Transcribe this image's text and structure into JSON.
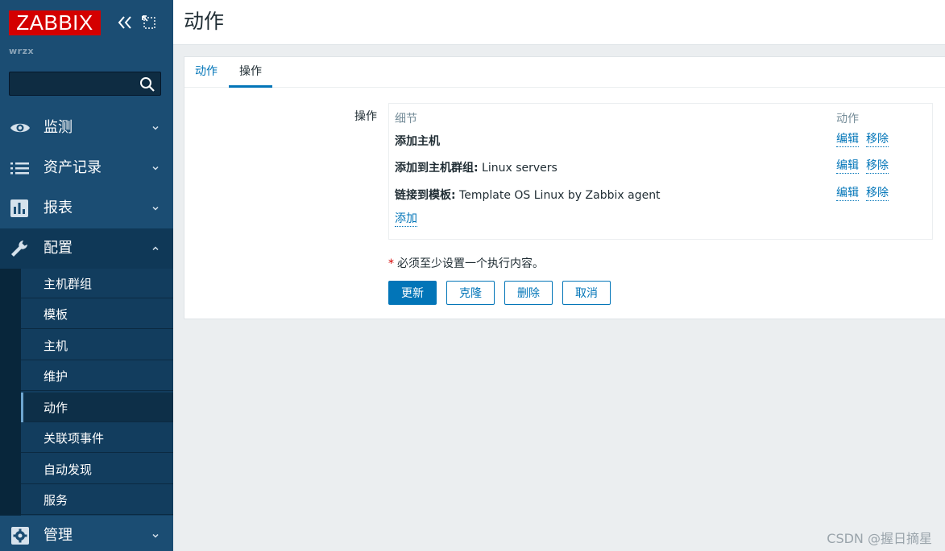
{
  "sidebar": {
    "logo": "ZABBIX",
    "server_name": "wrzx",
    "search": {
      "value": "",
      "placeholder": ""
    },
    "menu": [
      {
        "label": "监测",
        "icon": "eye-icon",
        "expanded": false
      },
      {
        "label": "资产记录",
        "icon": "list-icon",
        "expanded": false
      },
      {
        "label": "报表",
        "icon": "bar-chart-icon",
        "expanded": false
      },
      {
        "label": "配置",
        "icon": "wrench-icon",
        "expanded": true
      },
      {
        "label": "管理",
        "icon": "gear-icon",
        "expanded": false
      }
    ],
    "submenu": [
      {
        "label": "主机群组"
      },
      {
        "label": "模板"
      },
      {
        "label": "主机"
      },
      {
        "label": "维护"
      },
      {
        "label": "动作",
        "selected": true
      },
      {
        "label": "关联项事件"
      },
      {
        "label": "自动发现"
      },
      {
        "label": "服务"
      }
    ]
  },
  "header": {
    "title": "动作"
  },
  "tabs": [
    {
      "label": "动作",
      "active": false
    },
    {
      "label": "操作",
      "active": true
    }
  ],
  "operations": {
    "field_label": "操作",
    "columns": {
      "details": "细节",
      "action": "动作"
    },
    "rows": [
      {
        "prefix": "添加主机",
        "suffix": "",
        "edit": "编辑",
        "remove": "移除"
      },
      {
        "prefix": "添加到主机群组:",
        "suffix": " Linux servers",
        "edit": "编辑",
        "remove": "移除"
      },
      {
        "prefix": "链接到模板:",
        "suffix": " Template OS Linux by Zabbix agent",
        "edit": "编辑",
        "remove": "移除"
      }
    ],
    "add_label": "添加"
  },
  "required_note": {
    "star": "*",
    "text": "必须至少设置一个执行内容。"
  },
  "buttons": {
    "update": "更新",
    "clone": "克隆",
    "delete": "删除",
    "cancel": "取消"
  },
  "watermark": "CSDN @握日摘星",
  "colors": {
    "sidebar_bg": "#1b4d73",
    "accent": "#0275b8",
    "logo_red": "#d40000"
  }
}
